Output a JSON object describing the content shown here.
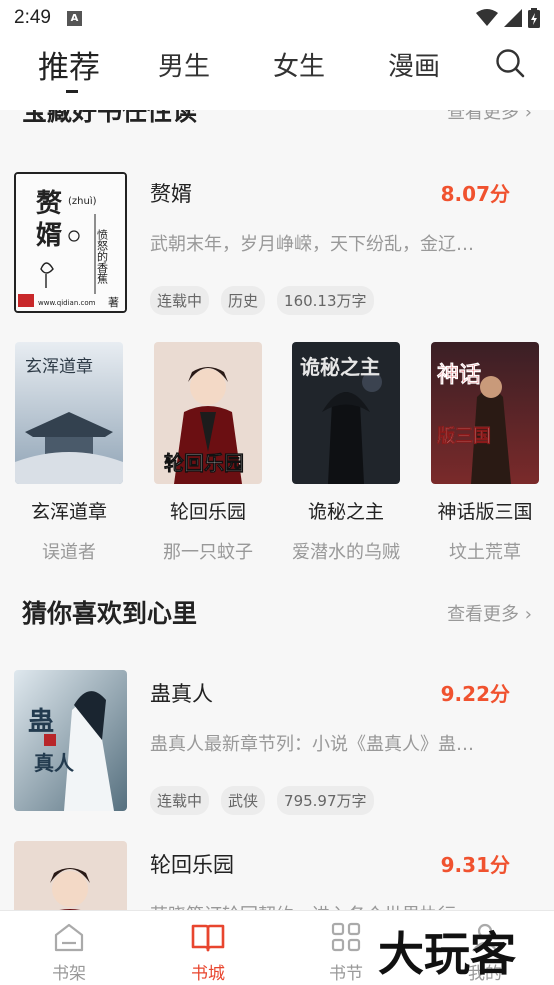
{
  "status": {
    "time": "2:49",
    "notice": "A"
  },
  "top_tabs": [
    {
      "label": "推荐"
    },
    {
      "label": "男生"
    },
    {
      "label": "女生"
    },
    {
      "label": "漫画"
    }
  ],
  "clipped_section": {
    "title": "宝藏好书任性读",
    "more": "查看更多"
  },
  "featured": {
    "title": "赘婿",
    "score": "8.07分",
    "desc": "武朝末年，岁月峥嵘，天下纷乱，金辽…",
    "tags": [
      "连载中",
      "历史",
      "160.13万字"
    ],
    "cover_text": {
      "main": "赘婿",
      "pinyin": "(zhuì)",
      "author": "愤怒的香蕉著",
      "site": "www.qidian.com"
    }
  },
  "grid_books": [
    {
      "title": "玄浑道章",
      "author": "误道者",
      "cover_text": "玄浑道章"
    },
    {
      "title": "轮回乐园",
      "author": "那一只蚊子",
      "cover_text": "轮回乐园"
    },
    {
      "title": "诡秘之主",
      "author": "爱潜水的乌贼",
      "cover_text": "诡秘之主"
    },
    {
      "title": "神话版三国",
      "author": "坟土荒草",
      "cover_text": "神话版三国"
    }
  ],
  "section2": {
    "title": "猜你喜欢到心里",
    "more": "查看更多"
  },
  "book2": {
    "title": "蛊真人",
    "score": "9.22分",
    "desc": "蛊真人最新章节列：小说《蛊真人》蛊…",
    "tags": [
      "连载中",
      "武侠",
      "795.97万字"
    ],
    "cover_text": "蛊真人"
  },
  "book3": {
    "title": "轮回乐园",
    "score": "9.31分",
    "desc": "苏晓签订轮回契约，进入各个世界执行…"
  },
  "bottom_nav": [
    {
      "label": "书架"
    },
    {
      "label": "书城"
    },
    {
      "label": "书节"
    },
    {
      "label": "我的"
    }
  ],
  "watermark": "大玩客",
  "colors": {
    "accent": "#f0522f",
    "nav_active": "#e8452e"
  }
}
